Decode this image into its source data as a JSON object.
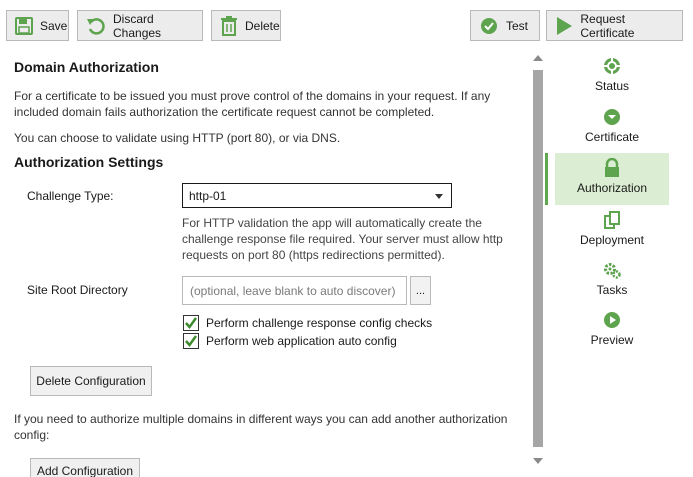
{
  "toolbar": {
    "save_label": "Save",
    "discard_label": "Discard Changes",
    "delete_label": "Delete",
    "test_label": "Test",
    "request_label": "Request Certificate"
  },
  "main": {
    "domain_auth_heading": "Domain Authorization",
    "domain_auth_text": "For a certificate to be issued you must prove control of the domains in your request. If any included domain fails authorization the certificate request cannot be completed.",
    "validate_text": "You can choose to validate using HTTP (port 80), or via DNS.",
    "auth_settings_heading": "Authorization Settings",
    "challenge_type_label": "Challenge Type:",
    "challenge_type_value": "http-01",
    "http_help_text": "For HTTP validation the app will automatically create the challenge response file required. Your server must allow http requests on port 80 (https redirections permitted).",
    "site_root_label": "Site Root Directory",
    "site_root_value": "",
    "site_root_placeholder": "(optional, leave blank to auto discover)",
    "browse_label": "...",
    "check_config_label": "Perform challenge response config checks",
    "check_config_checked": true,
    "auto_config_label": "Perform web application auto config",
    "auto_config_checked": true,
    "delete_config_label": "Delete Configuration",
    "multi_domain_text": "If you need to authorize multiple domains in different ways you can add another authorization config:",
    "add_config_label": "Add Configuration"
  },
  "nav": {
    "items": [
      {
        "label": "Status",
        "icon": "status-icon"
      },
      {
        "label": "Certificate",
        "icon": "certificate-icon"
      },
      {
        "label": "Authorization",
        "icon": "lock-icon",
        "active": true
      },
      {
        "label": "Deployment",
        "icon": "deployment-icon"
      },
      {
        "label": "Tasks",
        "icon": "gears-icon"
      },
      {
        "label": "Preview",
        "icon": "play-icon"
      }
    ]
  },
  "colors": {
    "accent_green": "#60a850",
    "active_nav_bg": "#dbeed3",
    "icon_green": "#5ea34e",
    "button_bg": "#ececec"
  }
}
